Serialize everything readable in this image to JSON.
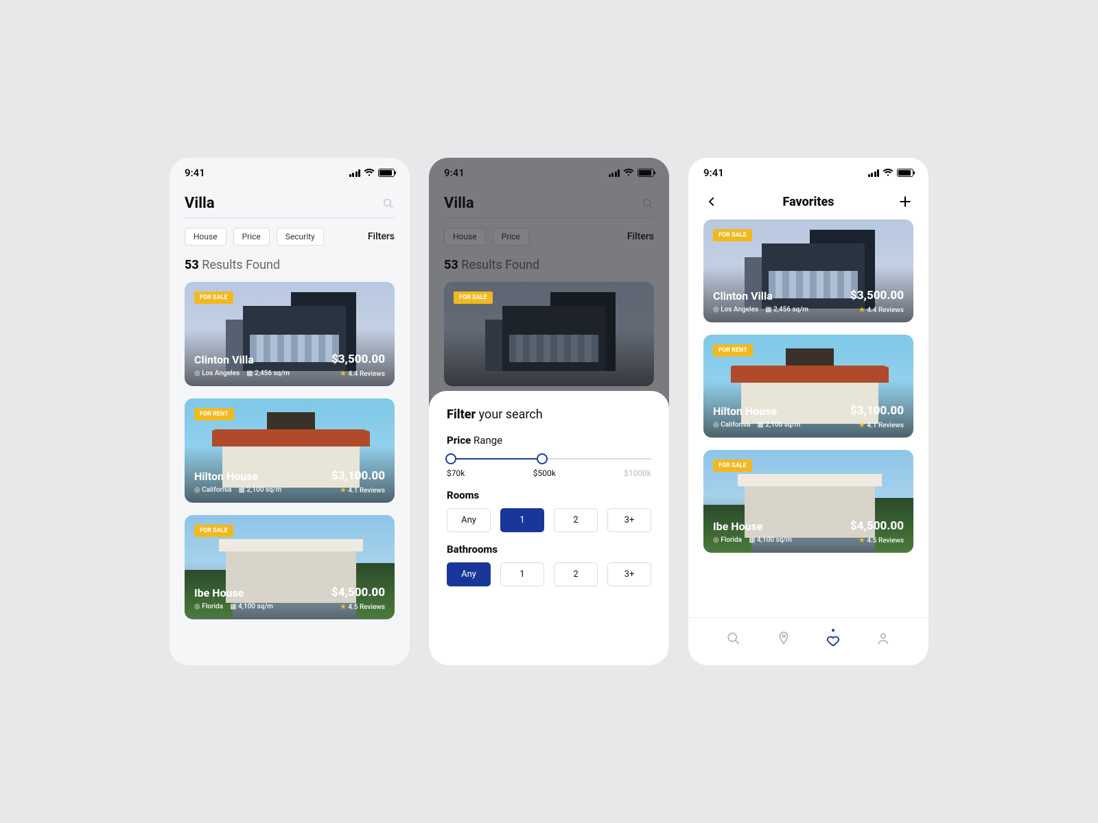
{
  "status_time": "9:41",
  "screen1": {
    "search_term": "Villa",
    "chips": [
      "House",
      "Price",
      "Security"
    ],
    "filters_label": "Filters",
    "results_count": "53",
    "results_suffix": "Results Found",
    "cards": [
      {
        "tag": "FOR SALE",
        "name": "Clinton Villa",
        "location": "Los Angeles",
        "area": "2,456 sq/m",
        "price": "$3,500.00",
        "rating": "4.4 Reviews"
      },
      {
        "tag": "FOR RENT",
        "name": "Hilton House",
        "location": "California",
        "area": "2,100 sq/m",
        "price": "$3,100.00",
        "rating": "4.1 Reviews"
      },
      {
        "tag": "FOR SALE",
        "name": "Ibe House",
        "location": "Florida",
        "area": "4,100 sq/m",
        "price": "$4,500.00",
        "rating": "4.5 Reviews"
      }
    ]
  },
  "screen2": {
    "chips": [
      "House",
      "Price"
    ],
    "filters_label": "Filters",
    "results_count": "53",
    "results_suffix": "Results Found",
    "modal": {
      "title_bold": "Filter",
      "title_rest": "your search",
      "price_bold": "Price",
      "price_rest": "Range",
      "price_labels": [
        "$70k",
        "$500k",
        "$1000k"
      ],
      "rooms_label": "Rooms",
      "rooms_opts": [
        "Any",
        "1",
        "2",
        "3+"
      ],
      "rooms_selected": "1",
      "baths_label": "Bathrooms",
      "baths_opts": [
        "Any",
        "1",
        "2",
        "3+"
      ],
      "baths_selected": "Any"
    }
  },
  "screen3": {
    "title": "Favorites",
    "cards": [
      {
        "tag": "FOR SALE",
        "name": "Clinton Villa",
        "location": "Los Angeles",
        "area": "2,456 sq/m",
        "price": "$3,500.00",
        "rating": "4.4 Reviews"
      },
      {
        "tag": "FOR RENT",
        "name": "Hilton House",
        "location": "California",
        "area": "2,100 sq/m",
        "price": "$3,100.00",
        "rating": "4.1 Reviews"
      },
      {
        "tag": "FOR SALE",
        "name": "Ibe House",
        "location": "Florida",
        "area": "4,100 sq/m",
        "price": "$4,500.00",
        "rating": "4.5 Reviews"
      }
    ],
    "nav_active": "favorites"
  },
  "colors": {
    "accent": "#19379a",
    "tag": "#f2b91e",
    "star": "#f4c223"
  }
}
